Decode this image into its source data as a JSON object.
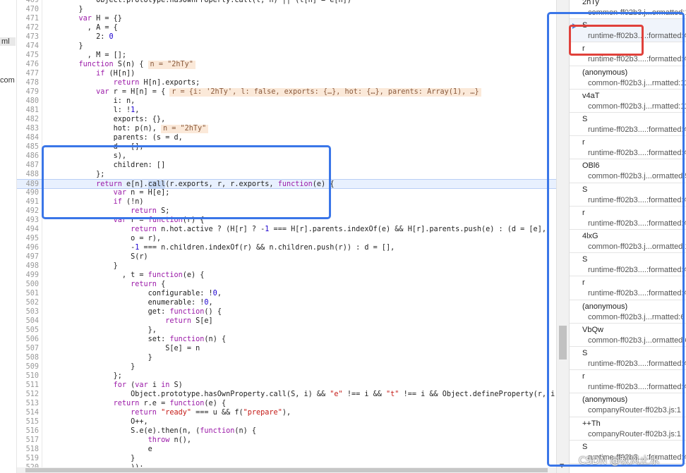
{
  "sidebar_fragments": [
    {
      "text": "ml",
      "highlight": true
    },
    {
      "text": "com",
      "highlight": false
    }
  ],
  "code": {
    "current_line": 488,
    "lines": [
      {
        "n": "469",
        "segs": [
          [
            "",
            "        Object.prototype.hasOwnProperty.call(t, n) || (t[n] = e[n])"
          ]
        ]
      },
      {
        "n": "470",
        "segs": [
          [
            "",
            "    }"
          ]
        ]
      },
      {
        "n": "471",
        "segs": [
          [
            "kw",
            "    var"
          ],
          [
            "",
            " H = {}"
          ]
        ]
      },
      {
        "n": "472",
        "segs": [
          [
            "",
            "      , A = {"
          ]
        ]
      },
      {
        "n": "473",
        "segs": [
          [
            "",
            "        2: "
          ],
          [
            "num",
            "0"
          ]
        ]
      },
      {
        "n": "474",
        "segs": [
          [
            "",
            "    }"
          ]
        ]
      },
      {
        "n": "475",
        "segs": [
          [
            "",
            "      , M = [];"
          ]
        ]
      },
      {
        "n": "476",
        "segs": [
          [
            "kw",
            "    function"
          ],
          [
            "",
            " S(n) {"
          ]
        ],
        "inline": "n = \"2hTy\""
      },
      {
        "n": "477",
        "segs": [
          [
            "kw",
            "        if"
          ],
          [
            "",
            " (H[n])"
          ]
        ]
      },
      {
        "n": "478",
        "segs": [
          [
            "kw",
            "            return"
          ],
          [
            "",
            " H[n].exports;"
          ]
        ]
      },
      {
        "n": "479",
        "segs": [
          [
            "kw",
            "        var"
          ],
          [
            "",
            " r = H[n] = {"
          ]
        ],
        "inline": "r = {i: '2hTy', l: false, exports: {…}, hot: {…}, parents: Array(1), …}"
      },
      {
        "n": "480",
        "segs": [
          [
            "",
            "            i: n,"
          ]
        ]
      },
      {
        "n": "481",
        "segs": [
          [
            "",
            "            l: !"
          ],
          [
            "num",
            "1"
          ],
          [
            "",
            ","
          ]
        ]
      },
      {
        "n": "482",
        "segs": [
          [
            "",
            "            exports: {},"
          ]
        ]
      },
      {
        "n": "483",
        "segs": [
          [
            "",
            "            hot: p(n),"
          ]
        ],
        "inline": "n = \"2hTy\""
      },
      {
        "n": "484",
        "segs": [
          [
            "",
            "            parents: (s = d,"
          ]
        ]
      },
      {
        "n": "485",
        "segs": [
          [
            "",
            "            d = [],"
          ]
        ]
      },
      {
        "n": "486",
        "segs": [
          [
            "",
            "            s),"
          ]
        ]
      },
      {
        "n": "487",
        "segs": [
          [
            "",
            "            children: []"
          ]
        ]
      },
      {
        "n": "488",
        "segs": [
          [
            "",
            "        };"
          ]
        ]
      },
      {
        "n": "489",
        "segs": [
          [
            "kw",
            "        return"
          ],
          [
            "",
            " e[n]."
          ],
          [
            "sel",
            "call"
          ],
          [
            "",
            "(r.exports, r, r.exports, "
          ],
          [
            "kw",
            "function"
          ],
          [
            "",
            "(e) {"
          ]
        ]
      },
      {
        "n": "490",
        "segs": [
          [
            "kw",
            "            var"
          ],
          [
            "",
            " n = H[e];"
          ]
        ]
      },
      {
        "n": "491",
        "segs": [
          [
            "kw",
            "            if"
          ],
          [
            "",
            " (!n)"
          ]
        ]
      },
      {
        "n": "492",
        "segs": [
          [
            "kw",
            "                return"
          ],
          [
            "",
            " S;"
          ]
        ]
      },
      {
        "n": "493",
        "segs": [
          [
            "kw",
            "            var"
          ],
          [
            "",
            " r = "
          ],
          [
            "kw",
            "function"
          ],
          [
            "",
            "(r) {"
          ]
        ]
      },
      {
        "n": "494",
        "segs": [
          [
            "kw",
            "                return"
          ],
          [
            "",
            " n.hot.active ? (H[r] ? -"
          ],
          [
            "num",
            "1"
          ],
          [
            "",
            " === H[r].parents.indexOf(e) && H[r].parents.push(e) : (d = [e],"
          ]
        ]
      },
      {
        "n": "495",
        "segs": [
          [
            "",
            "                o = r),"
          ]
        ]
      },
      {
        "n": "496",
        "segs": [
          [
            "",
            "                -"
          ],
          [
            "num",
            "1"
          ],
          [
            "",
            " === n.children.indexOf(r) && n.children.push(r)) : d = [],"
          ]
        ]
      },
      {
        "n": "497",
        "segs": [
          [
            "",
            "                S(r)"
          ]
        ]
      },
      {
        "n": "498",
        "segs": [
          [
            "",
            "            }"
          ]
        ]
      },
      {
        "n": "499",
        "segs": [
          [
            "",
            "              , t = "
          ],
          [
            "kw",
            "function"
          ],
          [
            "",
            "(e) {"
          ]
        ]
      },
      {
        "n": "500",
        "segs": [
          [
            "kw",
            "                return"
          ],
          [
            "",
            " {"
          ]
        ]
      },
      {
        "n": "501",
        "segs": [
          [
            "",
            "                    configurable: !"
          ],
          [
            "num",
            "0"
          ],
          [
            "",
            ","
          ]
        ]
      },
      {
        "n": "502",
        "segs": [
          [
            "",
            "                    enumerable: !"
          ],
          [
            "num",
            "0"
          ],
          [
            "",
            ","
          ]
        ]
      },
      {
        "n": "503",
        "segs": [
          [
            "",
            "                    get: "
          ],
          [
            "kw",
            "function"
          ],
          [
            "",
            "() {"
          ]
        ]
      },
      {
        "n": "504",
        "segs": [
          [
            "kw",
            "                        return"
          ],
          [
            "",
            " S[e]"
          ]
        ]
      },
      {
        "n": "505",
        "segs": [
          [
            "",
            "                    },"
          ]
        ]
      },
      {
        "n": "506",
        "segs": [
          [
            "",
            "                    set: "
          ],
          [
            "kw",
            "function"
          ],
          [
            "",
            "(n) {"
          ]
        ]
      },
      {
        "n": "507",
        "segs": [
          [
            "",
            "                        S[e] = n"
          ]
        ]
      },
      {
        "n": "508",
        "segs": [
          [
            "",
            "                    }"
          ]
        ]
      },
      {
        "n": "509",
        "segs": [
          [
            "",
            "                }"
          ]
        ]
      },
      {
        "n": "510",
        "segs": [
          [
            "",
            "            };"
          ]
        ]
      },
      {
        "n": "511",
        "segs": [
          [
            "kw",
            "            for"
          ],
          [
            "",
            " ("
          ],
          [
            "kw",
            "var"
          ],
          [
            "",
            " i "
          ],
          [
            "kw",
            "in"
          ],
          [
            "",
            " S)"
          ]
        ]
      },
      {
        "n": "512",
        "segs": [
          [
            "",
            "                Object.prototype.hasOwnProperty.call(S, i) && "
          ],
          [
            "str",
            "\"e\""
          ],
          [
            "",
            " !== i && "
          ],
          [
            "str",
            "\"t\""
          ],
          [
            "",
            " !== i && Object.defineProperty(r, i, t(i));"
          ]
        ]
      },
      {
        "n": "513",
        "segs": [
          [
            "kw",
            "            return"
          ],
          [
            "",
            " r.e = "
          ],
          [
            "kw",
            "function"
          ],
          [
            "",
            "(e) {"
          ]
        ]
      },
      {
        "n": "514",
        "segs": [
          [
            "kw",
            "                return"
          ],
          [
            "",
            " "
          ],
          [
            "str",
            "\"ready\""
          ],
          [
            "",
            " === u && f("
          ],
          [
            "str",
            "\"prepare\""
          ],
          [
            "",
            "),"
          ]
        ]
      },
      {
        "n": "515",
        "segs": [
          [
            "",
            "                O++,"
          ]
        ]
      },
      {
        "n": "516",
        "segs": [
          [
            "",
            "                S.e(e).then(n, ("
          ],
          [
            "kw",
            "function"
          ],
          [
            "",
            "(n) {"
          ]
        ]
      },
      {
        "n": "517",
        "segs": [
          [
            "kw",
            "                    throw"
          ],
          [
            "",
            " n(),"
          ]
        ]
      },
      {
        "n": "518",
        "segs": [
          [
            "",
            "                    e"
          ]
        ]
      },
      {
        "n": "519",
        "segs": [
          [
            "",
            "                }"
          ]
        ]
      },
      {
        "n": "520",
        "segs": [
          [
            "",
            "                ));"
          ]
        ]
      }
    ]
  },
  "call_stack": {
    "frames": [
      {
        "fn": "2hTy",
        "loc": "common-ff02b3.j...ormatted:1"
      },
      {
        "fn": "S",
        "loc": "runtime-ff02b3....:formatted:4",
        "active": true
      },
      {
        "fn": "r",
        "loc": "runtime-ff02b3....:formatted:4"
      },
      {
        "fn": "(anonymous)",
        "loc": "common-ff02b3.j...rmatted:11"
      },
      {
        "fn": "v4aT",
        "loc": "common-ff02b3.j...rmatted:11"
      },
      {
        "fn": "S",
        "loc": "runtime-ff02b3....:formatted:4"
      },
      {
        "fn": "r",
        "loc": "runtime-ff02b3....:formatted:4"
      },
      {
        "fn": "OBl6",
        "loc": "common-ff02b3.j...ormatted:5"
      },
      {
        "fn": "S",
        "loc": "runtime-ff02b3....:formatted:4"
      },
      {
        "fn": "r",
        "loc": "runtime-ff02b3....:formatted:4"
      },
      {
        "fn": "4lxG",
        "loc": "common-ff02b3.j...ormatted:1"
      },
      {
        "fn": "S",
        "loc": "runtime-ff02b3....:formatted:4"
      },
      {
        "fn": "r",
        "loc": "runtime-ff02b3....:formatted:4"
      },
      {
        "fn": "(anonymous)",
        "loc": "common-ff02b3.j...rmatted:6"
      },
      {
        "fn": "VbQw",
        "loc": "common-ff02b3.j...ormatted:6"
      },
      {
        "fn": "S",
        "loc": "runtime-ff02b3....:formatted:4"
      },
      {
        "fn": "r",
        "loc": "runtime-ff02b3....:formatted:4"
      },
      {
        "fn": "(anonymous)",
        "loc": "companyRouter-ff02b3.js:1"
      },
      {
        "fn": "++Th",
        "loc": "companyRouter-ff02b3.js:1"
      },
      {
        "fn": "S",
        "loc": "runtime-ff02b3....:formatted:4"
      }
    ]
  },
  "watermark": "CSDN @秋风止水",
  "colors": {
    "annotation_blue": "#3a76e8",
    "annotation_red": "#e0413b",
    "current_line_bg": "#e8f0fe",
    "keyword": "#9b1aa8",
    "string": "#c41a16",
    "number": "#1c00cf",
    "inline_value_bg": "#fbe9d9"
  }
}
